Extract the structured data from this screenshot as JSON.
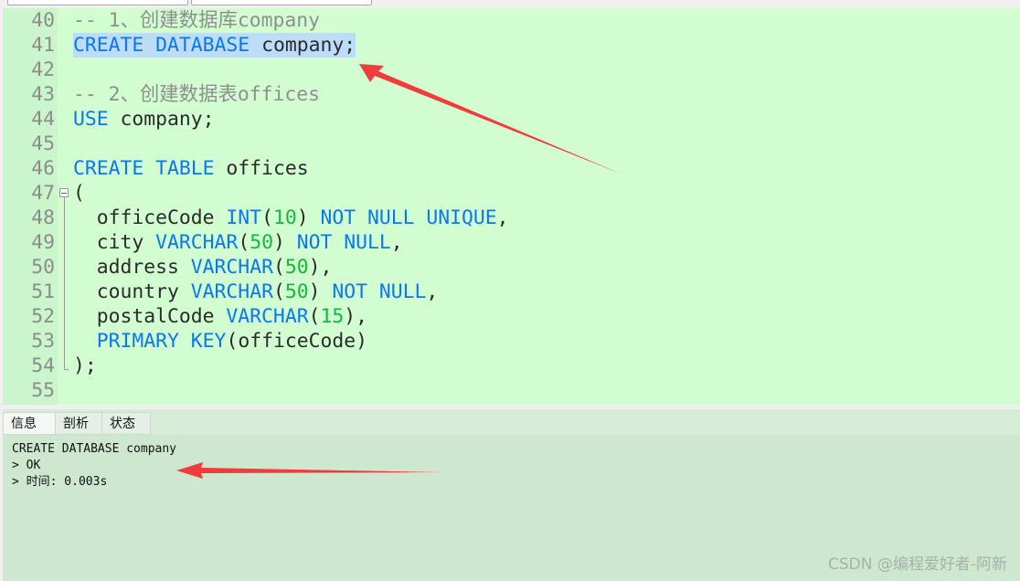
{
  "editor": {
    "lines": [
      {
        "n": "40",
        "tokens": [
          {
            "t": "cm",
            "v": "-- 1、创建数据库company"
          }
        ]
      },
      {
        "n": "41",
        "selected": true,
        "tokens": [
          {
            "t": "kw",
            "v": "CREATE DATABASE"
          },
          {
            "t": "",
            "v": " company;"
          }
        ]
      },
      {
        "n": "42",
        "tokens": []
      },
      {
        "n": "43",
        "tokens": [
          {
            "t": "cm",
            "v": "-- 2、创建数据表offices"
          }
        ]
      },
      {
        "n": "44",
        "tokens": [
          {
            "t": "kw",
            "v": "USE"
          },
          {
            "t": "",
            "v": " company;"
          }
        ]
      },
      {
        "n": "45",
        "tokens": []
      },
      {
        "n": "46",
        "tokens": [
          {
            "t": "kw",
            "v": "CREATE TABLE"
          },
          {
            "t": "",
            "v": " offices"
          }
        ]
      },
      {
        "n": "47",
        "tokens": [
          {
            "t": "",
            "v": "("
          }
        ]
      },
      {
        "n": "48",
        "tokens": [
          {
            "t": "",
            "v": "  officeCode "
          },
          {
            "t": "kw",
            "v": "INT"
          },
          {
            "t": "",
            "v": "("
          },
          {
            "t": "num",
            "v": "10"
          },
          {
            "t": "",
            "v": ") "
          },
          {
            "t": "kw",
            "v": "NOT NULL UNIQUE"
          },
          {
            "t": "",
            "v": ","
          }
        ]
      },
      {
        "n": "49",
        "tokens": [
          {
            "t": "",
            "v": "  city "
          },
          {
            "t": "kw",
            "v": "VARCHAR"
          },
          {
            "t": "",
            "v": "("
          },
          {
            "t": "num",
            "v": "50"
          },
          {
            "t": "",
            "v": ") "
          },
          {
            "t": "kw",
            "v": "NOT NULL"
          },
          {
            "t": "",
            "v": ","
          }
        ]
      },
      {
        "n": "50",
        "tokens": [
          {
            "t": "",
            "v": "  address "
          },
          {
            "t": "kw",
            "v": "VARCHAR"
          },
          {
            "t": "",
            "v": "("
          },
          {
            "t": "num",
            "v": "50"
          },
          {
            "t": "",
            "v": "),"
          }
        ]
      },
      {
        "n": "51",
        "tokens": [
          {
            "t": "",
            "v": "  country "
          },
          {
            "t": "kw",
            "v": "VARCHAR"
          },
          {
            "t": "",
            "v": "("
          },
          {
            "t": "num",
            "v": "50"
          },
          {
            "t": "",
            "v": ") "
          },
          {
            "t": "kw",
            "v": "NOT NULL"
          },
          {
            "t": "",
            "v": ","
          }
        ]
      },
      {
        "n": "52",
        "tokens": [
          {
            "t": "",
            "v": "  postalCode "
          },
          {
            "t": "kw",
            "v": "VARCHAR"
          },
          {
            "t": "",
            "v": "("
          },
          {
            "t": "num",
            "v": "15"
          },
          {
            "t": "",
            "v": "),"
          }
        ]
      },
      {
        "n": "53",
        "tokens": [
          {
            "t": "",
            "v": "  "
          },
          {
            "t": "kw",
            "v": "PRIMARY KEY"
          },
          {
            "t": "",
            "v": "(officeCode)"
          }
        ]
      },
      {
        "n": "54",
        "tokens": [
          {
            "t": "",
            "v": ");"
          }
        ]
      },
      {
        "n": "55",
        "tokens": []
      }
    ]
  },
  "panel": {
    "tabs": [
      "信息",
      "剖析",
      "状态"
    ],
    "active_tab": "信息",
    "output": [
      "CREATE DATABASE company",
      "> OK",
      "> 时间: 0.003s"
    ]
  },
  "watermark": "CSDN @编程爱好者-阿新",
  "colors": {
    "editor_bg": "#d1fdd1",
    "keyword": "#0a78f0",
    "number": "#14b83c",
    "comment": "#8f8f8f",
    "selection": "#bcdcf8",
    "arrow": "#f03c3c"
  }
}
